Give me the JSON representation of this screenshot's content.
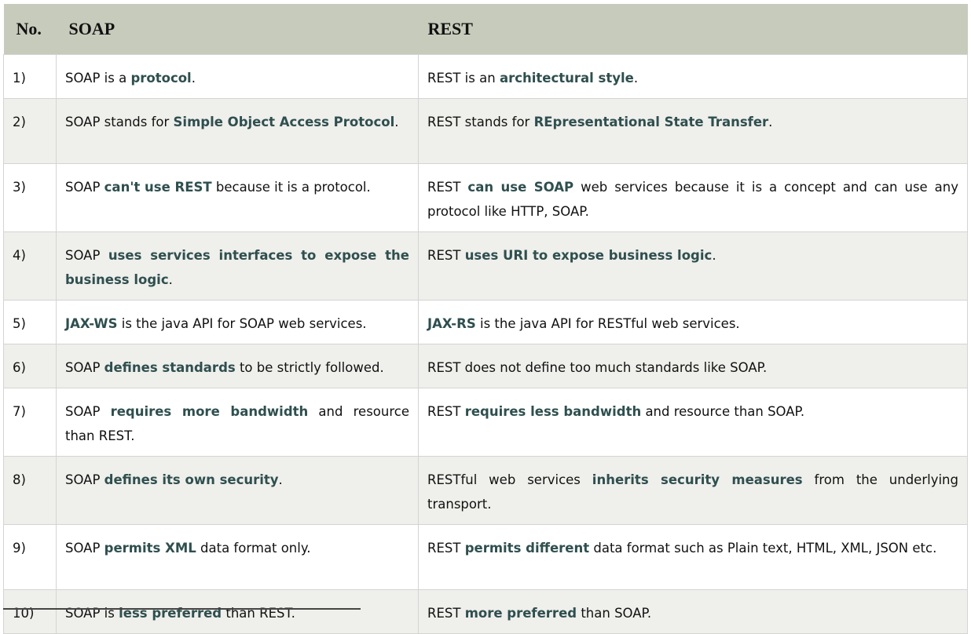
{
  "table": {
    "headers": {
      "no": "No.",
      "soap": "SOAP",
      "rest": "REST"
    },
    "colors": {
      "header_bg": "#c7cbbc",
      "highlight_text": "#2f4f4f",
      "alt_row_bg": "#efefeb"
    },
    "rows": [
      {
        "no": "1)",
        "soap": [
          {
            "t": "SOAP is a "
          },
          {
            "t": "protocol",
            "b": true
          },
          {
            "t": "."
          }
        ],
        "rest": [
          {
            "t": "REST is an "
          },
          {
            "t": "architectural style",
            "b": true
          },
          {
            "t": "."
          }
        ]
      },
      {
        "no": "2)",
        "soap": [
          {
            "t": "SOAP stands for "
          },
          {
            "t": "Simple Object Access Protocol",
            "b": true
          },
          {
            "t": "."
          }
        ],
        "rest": [
          {
            "t": "REST stands for "
          },
          {
            "t": "REpresentational State Transfer",
            "b": true
          },
          {
            "t": "."
          }
        ]
      },
      {
        "no": "3)",
        "soap": [
          {
            "t": "SOAP "
          },
          {
            "t": "can't use REST",
            "b": true
          },
          {
            "t": " because it is a protocol."
          }
        ],
        "rest": [
          {
            "t": "REST "
          },
          {
            "t": "can use SOAP",
            "b": true
          },
          {
            "t": " web services because it is a concept and can use any protocol like HTTP, SOAP."
          }
        ]
      },
      {
        "no": "4)",
        "soap": [
          {
            "t": "SOAP "
          },
          {
            "t": "uses services interfaces to expose the business logic",
            "b": true
          },
          {
            "t": "."
          }
        ],
        "rest": [
          {
            "t": "REST "
          },
          {
            "t": "uses URI to expose business logic",
            "b": true
          },
          {
            "t": "."
          }
        ]
      },
      {
        "no": "5)",
        "soap": [
          {
            "t": "JAX-WS",
            "b": true
          },
          {
            "t": " is the java API for SOAP web services."
          }
        ],
        "rest": [
          {
            "t": "JAX-RS",
            "b": true
          },
          {
            "t": " is the java API for RESTful web services."
          }
        ]
      },
      {
        "no": "6)",
        "soap": [
          {
            "t": "SOAP "
          },
          {
            "t": "defines standards",
            "b": true
          },
          {
            "t": " to be strictly followed."
          }
        ],
        "rest": [
          {
            "t": "REST does not define too much standards like SOAP."
          }
        ]
      },
      {
        "no": "7)",
        "soap": [
          {
            "t": "SOAP "
          },
          {
            "t": "requires more bandwidth",
            "b": true
          },
          {
            "t": " and resource than REST."
          }
        ],
        "rest": [
          {
            "t": "REST "
          },
          {
            "t": "requires less bandwidth",
            "b": true
          },
          {
            "t": " and resource than SOAP."
          }
        ]
      },
      {
        "no": "8)",
        "soap": [
          {
            "t": "SOAP "
          },
          {
            "t": "defines its own security",
            "b": true
          },
          {
            "t": "."
          }
        ],
        "rest": [
          {
            "t": "RESTful web services "
          },
          {
            "t": "inherits security measures",
            "b": true
          },
          {
            "t": " from the underlying transport."
          }
        ]
      },
      {
        "no": "9)",
        "soap": [
          {
            "t": "SOAP "
          },
          {
            "t": "permits XML",
            "b": true
          },
          {
            "t": " data format only."
          }
        ],
        "rest": [
          {
            "t": "REST "
          },
          {
            "t": "permits different",
            "b": true
          },
          {
            "t": " data format such as Plain text, HTML, XML, JSON etc."
          }
        ]
      },
      {
        "no": "10)",
        "soap": [
          {
            "t": "SOAP is "
          },
          {
            "t": "less preferred",
            "b": true
          },
          {
            "t": " than REST."
          }
        ],
        "rest": [
          {
            "t": "REST "
          },
          {
            "t": "more preferred",
            "b": true
          },
          {
            "t": " than SOAP."
          }
        ]
      }
    ]
  }
}
